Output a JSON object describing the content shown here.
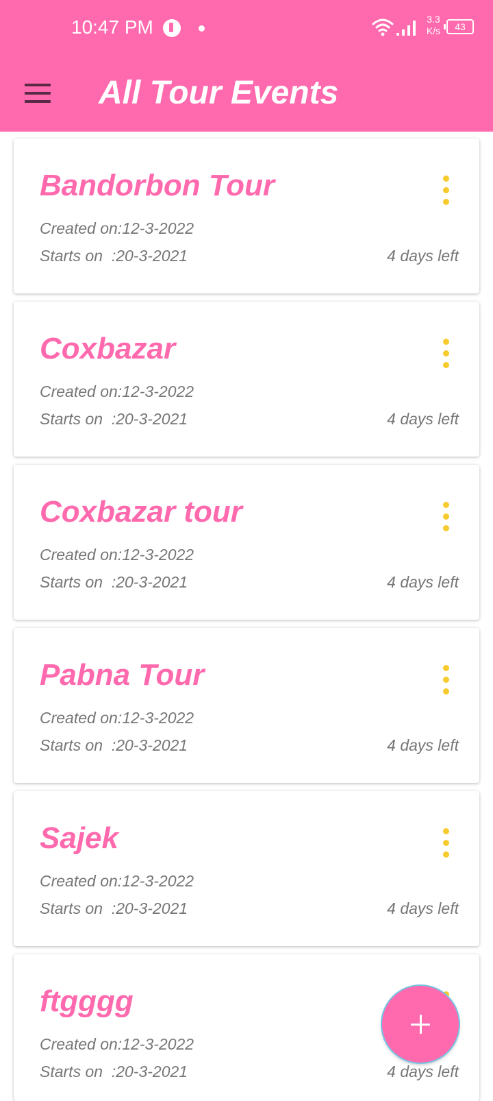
{
  "status_bar": {
    "time": "10:47 PM",
    "network_speed_value": "3.3",
    "network_speed_unit": "K/s",
    "battery": "43",
    "icons": [
      "app-notification-icon",
      "dot-icon",
      "wifi-icon",
      "cell-signal-icon",
      "battery-icon"
    ]
  },
  "app_bar": {
    "title": "All Tour Events",
    "menu_icon": "hamburger-menu-icon",
    "background_color": "#ff69ad"
  },
  "events": [
    {
      "title": "Bandorbon Tour",
      "created_label": "Created on:",
      "created_date": "12-3-2022",
      "starts_label": "Starts on  :",
      "starts_date": "20-3-2021",
      "days_left": "4 days left"
    },
    {
      "title": "Coxbazar",
      "created_label": "Created on:",
      "created_date": "12-3-2022",
      "starts_label": "Starts on  :",
      "starts_date": "20-3-2021",
      "days_left": "4 days left"
    },
    {
      "title": "Coxbazar tour",
      "created_label": "Created on:",
      "created_date": "12-3-2022",
      "starts_label": "Starts on  :",
      "starts_date": "20-3-2021",
      "days_left": "4 days left"
    },
    {
      "title": "Pabna Tour",
      "created_label": "Created on:",
      "created_date": "12-3-2022",
      "starts_label": "Starts on  :",
      "starts_date": "20-3-2021",
      "days_left": "4 days left"
    },
    {
      "title": "Sajek",
      "created_label": "Created on:",
      "created_date": "12-3-2022",
      "starts_label": "Starts on  :",
      "starts_date": "20-3-2021",
      "days_left": "4 days left"
    },
    {
      "title": "ftgggg",
      "created_label": "Created on:",
      "created_date": "12-3-2022",
      "starts_label": "Starts on  :",
      "starts_date": "20-3-2021",
      "days_left": "4 days left"
    }
  ],
  "fab": {
    "icon": "plus-icon"
  },
  "colors": {
    "accent": "#ff69ad",
    "more_icon": "#f7ca2e",
    "meta_text": "#767676"
  }
}
